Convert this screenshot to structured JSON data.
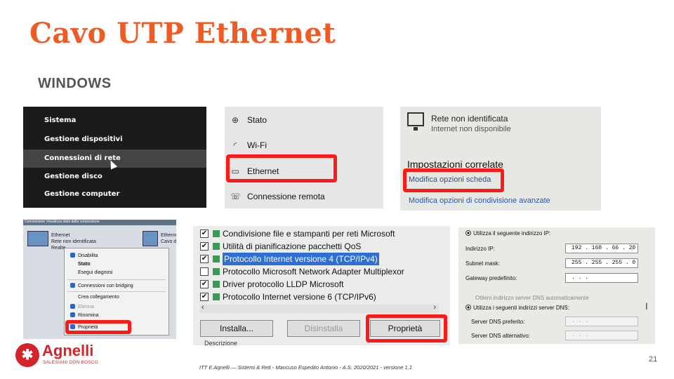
{
  "title": "Cavo UTP Ethernet",
  "subtitle": "WINDOWS",
  "shot1": {
    "items": [
      "Sistema",
      "Gestione dispositivi",
      "Connessioni di rete",
      "Gestione disco",
      "Gestione computer"
    ]
  },
  "shot2": {
    "items": [
      {
        "icon": "⊕",
        "label": "Stato"
      },
      {
        "icon": "◜",
        "label": "Wi-Fi"
      },
      {
        "icon": "▭",
        "label": "Ethernet"
      },
      {
        "icon": "☏",
        "label": "Connessione remota"
      }
    ]
  },
  "shot3": {
    "network_name": "Rete non identificata",
    "network_status": "Internet non disponibile",
    "section_title": "Impostazioni correlate",
    "link1": "Modifica opzioni scheda",
    "link2": "Modifica opzioni di condivisione avanzate"
  },
  "shot4": {
    "header": "Connessione  Visualizza stato della connessione",
    "adapter_name": "Ethernet",
    "adapter_status": "Rete non identificata",
    "adapter_device": "Realte",
    "adapter2_name": "Etherne",
    "adapter2_status": "Cavo d",
    "menu": [
      "Disabilita",
      "Stato",
      "Esegui diagnosi",
      "Connessioni con bridging",
      "Crea collegamento",
      "Elimina",
      "Rinomina",
      "Proprietà"
    ]
  },
  "shot5": {
    "protocols": [
      {
        "checked": true,
        "label": "Condivisione file e stampanti per reti Microsoft",
        "selected": false
      },
      {
        "checked": true,
        "label": "Utilità di pianificazione pacchetti QoS",
        "selected": false
      },
      {
        "checked": true,
        "label": "Protocollo Internet versione 4 (TCP/IPv4)",
        "selected": true
      },
      {
        "checked": false,
        "label": "Protocollo Microsoft Network Adapter Multiplexor",
        "selected": false
      },
      {
        "checked": true,
        "label": "Driver protocollo LLDP Microsoft",
        "selected": false
      },
      {
        "checked": true,
        "label": "Protocollo Internet versione 6 (TCP/IPv6)",
        "selected": false
      }
    ],
    "install_button": "Installa...",
    "uninstall_button": "Disinstalla",
    "properties_button": "Proprietà",
    "description_label": "Descrizione"
  },
  "shot6": {
    "use_ip_label": "Utilizza il seguente indirizzo IP:",
    "ip_label": "Indirizzo IP:",
    "ip_value": "192 . 168 . 66 . 20",
    "mask_label": "Subnet mask:",
    "mask_value": "255 . 255 . 255 . 0",
    "gateway_label": "Gateway predefinito:",
    "gateway_value": ".    .    .",
    "auto_dns_label": "Ottieni indirizzo server DNS automaticamente",
    "use_dns_label": "Utilizza i seguenti indirizzi server DNS:",
    "dns_pref_label": "Server DNS preferito:",
    "dns_pref_value": ".    .    .",
    "dns_alt_label": "Server DNS alternativo:",
    "dns_alt_value": ".    .    ."
  },
  "footer": {
    "logo_name": "Agnelli",
    "logo_tagline": "SALESIANI DON BOSCO",
    "credit": "ITT E.Agnelli — Sistemi & Reti - Mancuso Espedito Antonio - A.S. 2020/2021 - versione 1.1",
    "page_number": "21"
  },
  "colors": {
    "title": "#f05a23",
    "highlight": "#ff1a1a",
    "brand": "#d4232c"
  }
}
